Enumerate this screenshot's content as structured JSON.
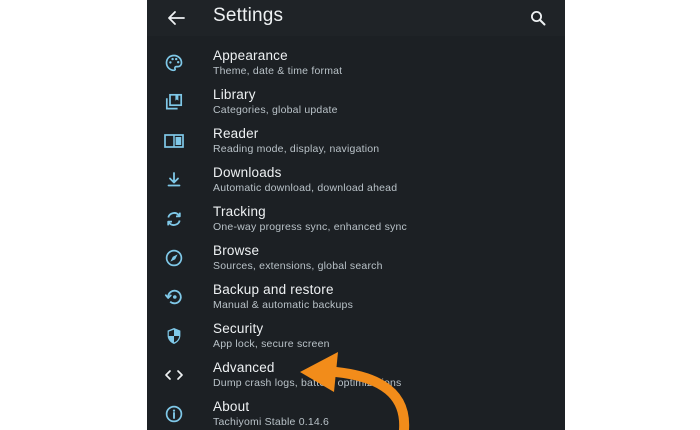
{
  "colors": {
    "background": "#1c2024",
    "icon_accent": "#7fc8e8",
    "text_primary": "#eef1f3",
    "text_secondary": "#b9c2c8",
    "annotation_arrow": "#f28c1a"
  },
  "appbar": {
    "title": "Settings",
    "back_icon": "arrow-left-icon",
    "search_icon": "search-icon"
  },
  "settings": [
    {
      "title": "Appearance",
      "subtitle": "Theme, date & time format",
      "icon": "palette-icon"
    },
    {
      "title": "Library",
      "subtitle": "Categories, global update",
      "icon": "library-icon"
    },
    {
      "title": "Reader",
      "subtitle": "Reading mode, display, navigation",
      "icon": "book-open-icon"
    },
    {
      "title": "Downloads",
      "subtitle": "Automatic download, download ahead",
      "icon": "download-icon"
    },
    {
      "title": "Tracking",
      "subtitle": "One-way progress sync, enhanced sync",
      "icon": "sync-icon"
    },
    {
      "title": "Browse",
      "subtitle": "Sources, extensions, global search",
      "icon": "compass-icon"
    },
    {
      "title": "Backup and restore",
      "subtitle": "Manual & automatic backups",
      "icon": "backup-restore-icon"
    },
    {
      "title": "Security",
      "subtitle": "App lock, secure screen",
      "icon": "shield-icon"
    },
    {
      "title": "Advanced",
      "subtitle": "Dump crash logs, battery optimizations",
      "icon": "code-icon"
    },
    {
      "title": "About",
      "subtitle": "Tachiyomi Stable 0.14.6",
      "icon": "info-icon"
    }
  ]
}
